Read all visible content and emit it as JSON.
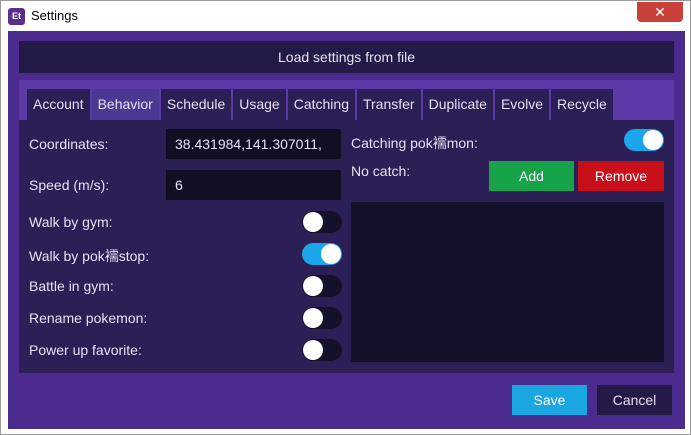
{
  "window": {
    "title": "Settings",
    "icon_text": "Et",
    "close_glyph": "✕"
  },
  "load_button": {
    "label": "Load settings from file"
  },
  "tabs": [
    {
      "label": "Account",
      "active": false
    },
    {
      "label": "Behavior",
      "active": true
    },
    {
      "label": "Schedule",
      "active": false
    },
    {
      "label": "Usage",
      "active": false
    },
    {
      "label": "Catching",
      "active": false
    },
    {
      "label": "Transfer",
      "active": false
    },
    {
      "label": "Duplicate",
      "active": false
    },
    {
      "label": "Evolve",
      "active": false
    },
    {
      "label": "Recycle",
      "active": false
    }
  ],
  "behavior": {
    "coordinates": {
      "label": "Coordinates:",
      "value": "38.431984,141.307011,"
    },
    "speed": {
      "label": "Speed (m/s):",
      "value": "6"
    },
    "toggles": [
      {
        "label": "Walk by gym:",
        "on": false
      },
      {
        "label": "Walk by pok襦stop:",
        "on": true
      },
      {
        "label": "Battle in gym:",
        "on": false
      },
      {
        "label": "Rename pokemon:",
        "on": false
      },
      {
        "label": "Power up favorite:",
        "on": false
      }
    ],
    "catching": {
      "label": "Catching pok襦mon:",
      "on": true
    },
    "no_catch": {
      "label": "No catch:",
      "add_label": "Add",
      "remove_label": "Remove"
    }
  },
  "footer": {
    "save_label": "Save",
    "cancel_label": "Cancel"
  },
  "colors": {
    "background": "#4b2c8e",
    "panel": "#5a3aa6",
    "content": "#2b1f55",
    "toggle_on": "#1aa6e8",
    "add": "#16a34a",
    "remove": "#c8101b",
    "save": "#1aa6e0"
  }
}
